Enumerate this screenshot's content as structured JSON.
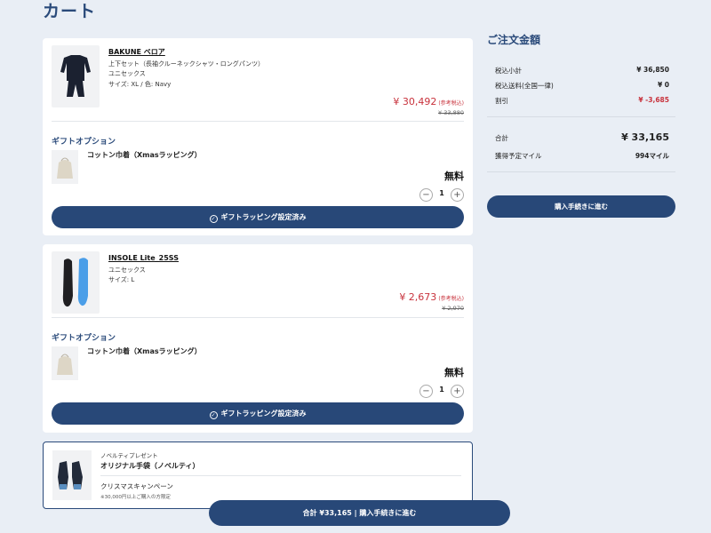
{
  "page": {
    "title": "カート"
  },
  "items": [
    {
      "name": "BAKUNE ベロア",
      "details": [
        "上下セット（長袖クルーネックシャツ・ロングパンツ）",
        "ユニセックス",
        "サイズ: XL / 色: Navy"
      ],
      "price": "¥ 30,492",
      "price_note": "(参考税込)",
      "old_price": "¥ 33,880",
      "gift_option_label": "ギフトオプション",
      "gift_name": "コットン巾着（Xmasラッピング）",
      "gift_price": "無料",
      "quantity": "1",
      "wrap_button_label": "ギフトラッピング設定済み"
    },
    {
      "name": "INSOLE Lite_25SS",
      "details": [
        "ユニセックス",
        "サイズ: L"
      ],
      "price": "¥ 2,673",
      "price_note": "(参考税込)",
      "old_price": "¥ 2,970",
      "gift_option_label": "ギフトオプション",
      "gift_name": "コットン巾着（Xmasラッピング）",
      "gift_price": "無料",
      "quantity": "1",
      "wrap_button_label": "ギフトラッピング設定済み"
    }
  ],
  "novelty": {
    "tag": "ノベルティプレゼント",
    "name": "オリジナル手袋（ノベルティ）",
    "campaign": "クリスマスキャンペーン",
    "condition": "※30,000円以上ご購入の方限定"
  },
  "summary": {
    "title": "ご注文金額",
    "subtotal_label": "税込小計",
    "subtotal": "¥ 36,850",
    "shipping_label": "税込送料(全国一律)",
    "shipping": "¥ 0",
    "discount_label": "割引",
    "discount": "¥ -3,685",
    "total_label": "合計",
    "total": "¥ 33,165",
    "miles_label": "獲得予定マイル",
    "miles": "994マイル",
    "proceed_label": "購入手続きに進む"
  },
  "sticky": {
    "label": "合計 ¥33,165 | 購入手続きに進む"
  },
  "colors": {
    "primary": "#284878",
    "accent_red": "#c8323c",
    "background": "#e9eef5"
  }
}
